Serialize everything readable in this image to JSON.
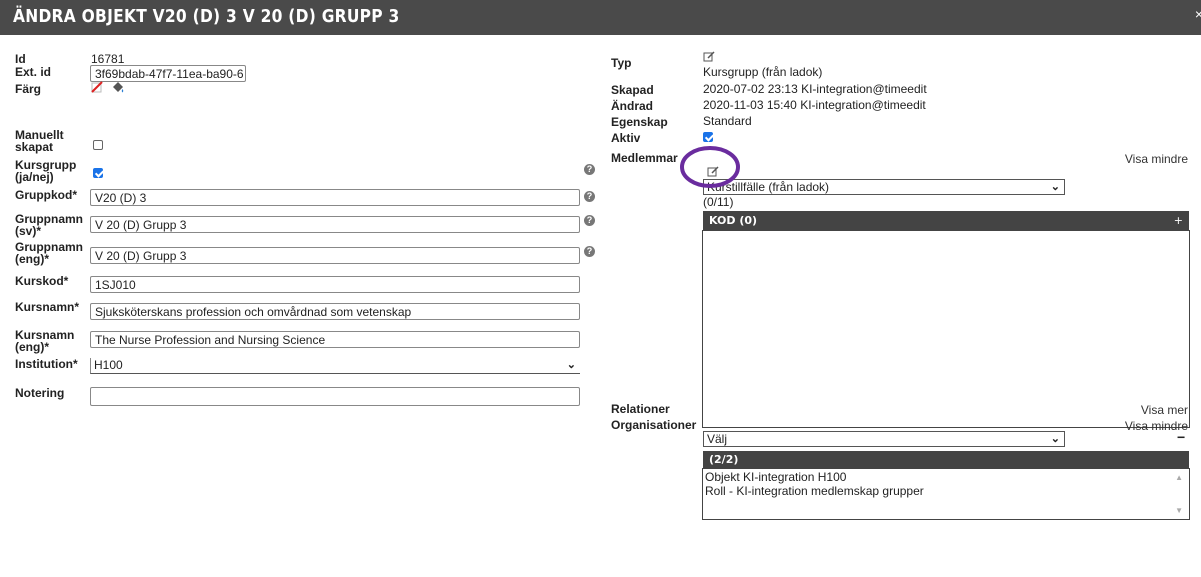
{
  "window": {
    "title": "ÄNDRA OBJEKT V20 (D) 3 V 20 (D) GRUPP 3",
    "close_label": "×"
  },
  "left": {
    "id_label": "Id",
    "id_value": "16781",
    "ext_label": "Ext. id",
    "ext_value": "3f69bdab-47f7-11ea-ba90-6",
    "farg_label": "Färg",
    "manuellt_label1": "Manuellt",
    "manuellt_label2": "skapat",
    "kursgrupp_label1": "Kursgrupp",
    "kursgrupp_label2": "(ja/nej)",
    "gruppkod_label": "Gruppkod*",
    "gruppkod_value": "V20 (D) 3",
    "gruppnamn_sv_label1": "Gruppnamn",
    "gruppnamn_sv_label2": "(sv)*",
    "gruppnamn_sv_value": "V 20 (D) Grupp 3",
    "gruppnamn_eng_label1": "Gruppnamn",
    "gruppnamn_eng_label2": "(eng)*",
    "gruppnamn_eng_value": "V 20 (D) Grupp 3",
    "kurskod_label": "Kurskod*",
    "kurskod_value": "1SJ010",
    "kursnamn_label": "Kursnamn*",
    "kursnamn_value": "Sjuksköterskans profession och omvårdnad som vetenskap",
    "kursnamn_eng_label1": "Kursnamn",
    "kursnamn_eng_label2": "(eng)*",
    "kursnamn_eng_value": "The Nurse Profession and Nursing Science",
    "institution_label": "Institution*",
    "institution_value": "H100",
    "notering_label": "Notering",
    "notering_value": "",
    "help_glyph": "?"
  },
  "right": {
    "typ_label": "Typ",
    "typ_value": "Kursgrupp (från ladok)",
    "skapad_label": "Skapad",
    "skapad_value": "2020-07-02 23:13 KI-integration@timeedit",
    "andrad_label": "Ändrad",
    "andrad_value": "2020-11-03 15:40 KI-integration@timeedit",
    "egenskap_label": "Egenskap",
    "egenskap_value": "Standard",
    "aktiv_label": "Aktiv",
    "medlemmar_label": "Medlemmar",
    "medlemmar_toggle": "Visa mindre",
    "medlemmar_select": "Kurstillfälle (från ladok)",
    "medlemmar_count": "(0/11)",
    "kod_header": "KOD (0)",
    "kod_add": "+",
    "relationer_label": "Relationer",
    "relationer_toggle": "Visa mer",
    "organisationer_label": "Organisationer",
    "organisationer_toggle": "Visa mindre",
    "org_select": "Välj",
    "org_remove": "−",
    "org_header": "(2/2)",
    "org_items": [
      "Objekt KI-integration H100",
      "Roll - KI-integration medlemskap grupper"
    ]
  },
  "colors": {
    "titlebar": "#4a4a4a",
    "highlight_circle": "#6a2c9e",
    "checkbox": "#1a73e8"
  }
}
